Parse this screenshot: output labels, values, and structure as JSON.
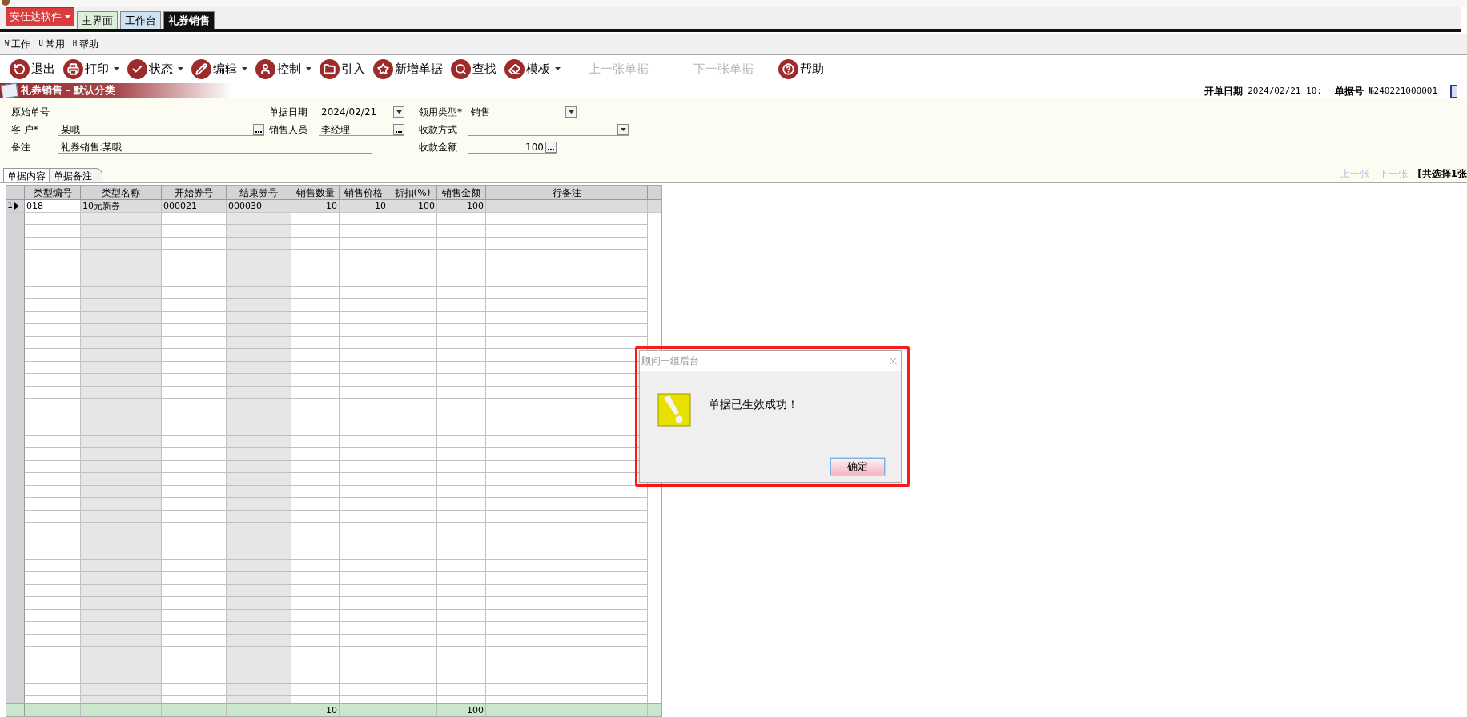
{
  "brand_menu": {
    "label": "安仕达软件"
  },
  "tabs": [
    {
      "label": "主界面",
      "selected": false,
      "color": "#dcefd8"
    },
    {
      "label": "工作台",
      "selected": false,
      "color": "#cfe2f3"
    },
    {
      "label": "礼券销售",
      "selected": true,
      "color": "#111111"
    }
  ],
  "menu": [
    {
      "hotkey": "W",
      "label": "工作"
    },
    {
      "hotkey": "U",
      "label": "常用"
    },
    {
      "hotkey": "H",
      "label": "帮助"
    }
  ],
  "toolbar": [
    {
      "label": "退出",
      "dropdown": false,
      "disabled": false
    },
    {
      "label": "打印",
      "dropdown": true,
      "disabled": false
    },
    {
      "label": "状态",
      "dropdown": true,
      "disabled": false
    },
    {
      "label": "编辑",
      "dropdown": true,
      "disabled": false
    },
    {
      "label": "控制",
      "dropdown": true,
      "disabled": false
    },
    {
      "label": "引入",
      "dropdown": false,
      "disabled": false
    },
    {
      "label": "新增单据",
      "dropdown": false,
      "disabled": false
    },
    {
      "label": "查找",
      "dropdown": false,
      "disabled": false
    },
    {
      "label": "模板",
      "dropdown": true,
      "disabled": false
    },
    {
      "label": "上一张单据",
      "dropdown": false,
      "disabled": true
    },
    {
      "label": "下一张单据",
      "dropdown": false,
      "disabled": true
    },
    {
      "label": "帮助",
      "dropdown": false,
      "disabled": false
    }
  ],
  "section_title": "礼券销售 - 默认分类",
  "header_info": [
    {
      "label": "开单日期",
      "value": "2024/02/21 10:"
    },
    {
      "label": "单据号",
      "value": "№240221000001"
    }
  ],
  "form": {
    "rows": [
      [
        {
          "label": "原始单号",
          "kind": "text"
        },
        {
          "label": "单据日期",
          "kind": "select",
          "value": "2024/02/21"
        },
        {
          "label": "领用类型*",
          "kind": "select",
          "value": "销售"
        }
      ],
      [
        {
          "label": "客 户*",
          "kind": "lookup",
          "value": "某哦"
        },
        {
          "label": "销售人员",
          "kind": "lookup",
          "value": "李经理"
        },
        {
          "label": "收款方式",
          "kind": "select"
        }
      ],
      [
        {
          "label": "备注",
          "kind": "text",
          "value": "礼券销售:某哦"
        },
        "",
        {
          "label": "收款金额",
          "kind": "amount",
          "value": "100"
        }
      ]
    ]
  },
  "doc_tabs": [
    {
      "label": "单据内容",
      "selected": true
    },
    {
      "label": "单据备注",
      "selected": false
    }
  ],
  "pager": [
    {
      "label": "上一张",
      "disabled": true
    },
    {
      "label": "下一张",
      "disabled": true
    }
  ],
  "selection_summary": "[共选择1张",
  "table": {
    "columns": [
      {
        "label": "类型编号",
        "kind": "text",
        "readonly": false
      },
      {
        "label": "类型名称",
        "kind": "text",
        "readonly": true
      },
      {
        "label": "开始券号",
        "kind": "text",
        "readonly": false
      },
      {
        "label": "结束券号",
        "kind": "text",
        "readonly": true
      },
      {
        "label": "销售数量",
        "kind": "number",
        "readonly": false,
        "total": "10"
      },
      {
        "label": "销售价格",
        "kind": "number",
        "readonly": false
      },
      {
        "label": "折扣(%)",
        "kind": "number",
        "readonly": false
      },
      {
        "label": "销售金额",
        "kind": "number",
        "readonly": false,
        "total": "100"
      },
      {
        "label": "行备注",
        "kind": "text",
        "readonly": false
      }
    ],
    "rows": [
      {
        "number": "1",
        "selected": true,
        "cells": [
          "018",
          "10元新券",
          "000021",
          "000030",
          "10",
          "10",
          "100",
          "100"
        ]
      }
    ]
  },
  "dialog": {
    "title": "顾问一组后台",
    "message": "单据已生效成功！",
    "button": "确定"
  }
}
